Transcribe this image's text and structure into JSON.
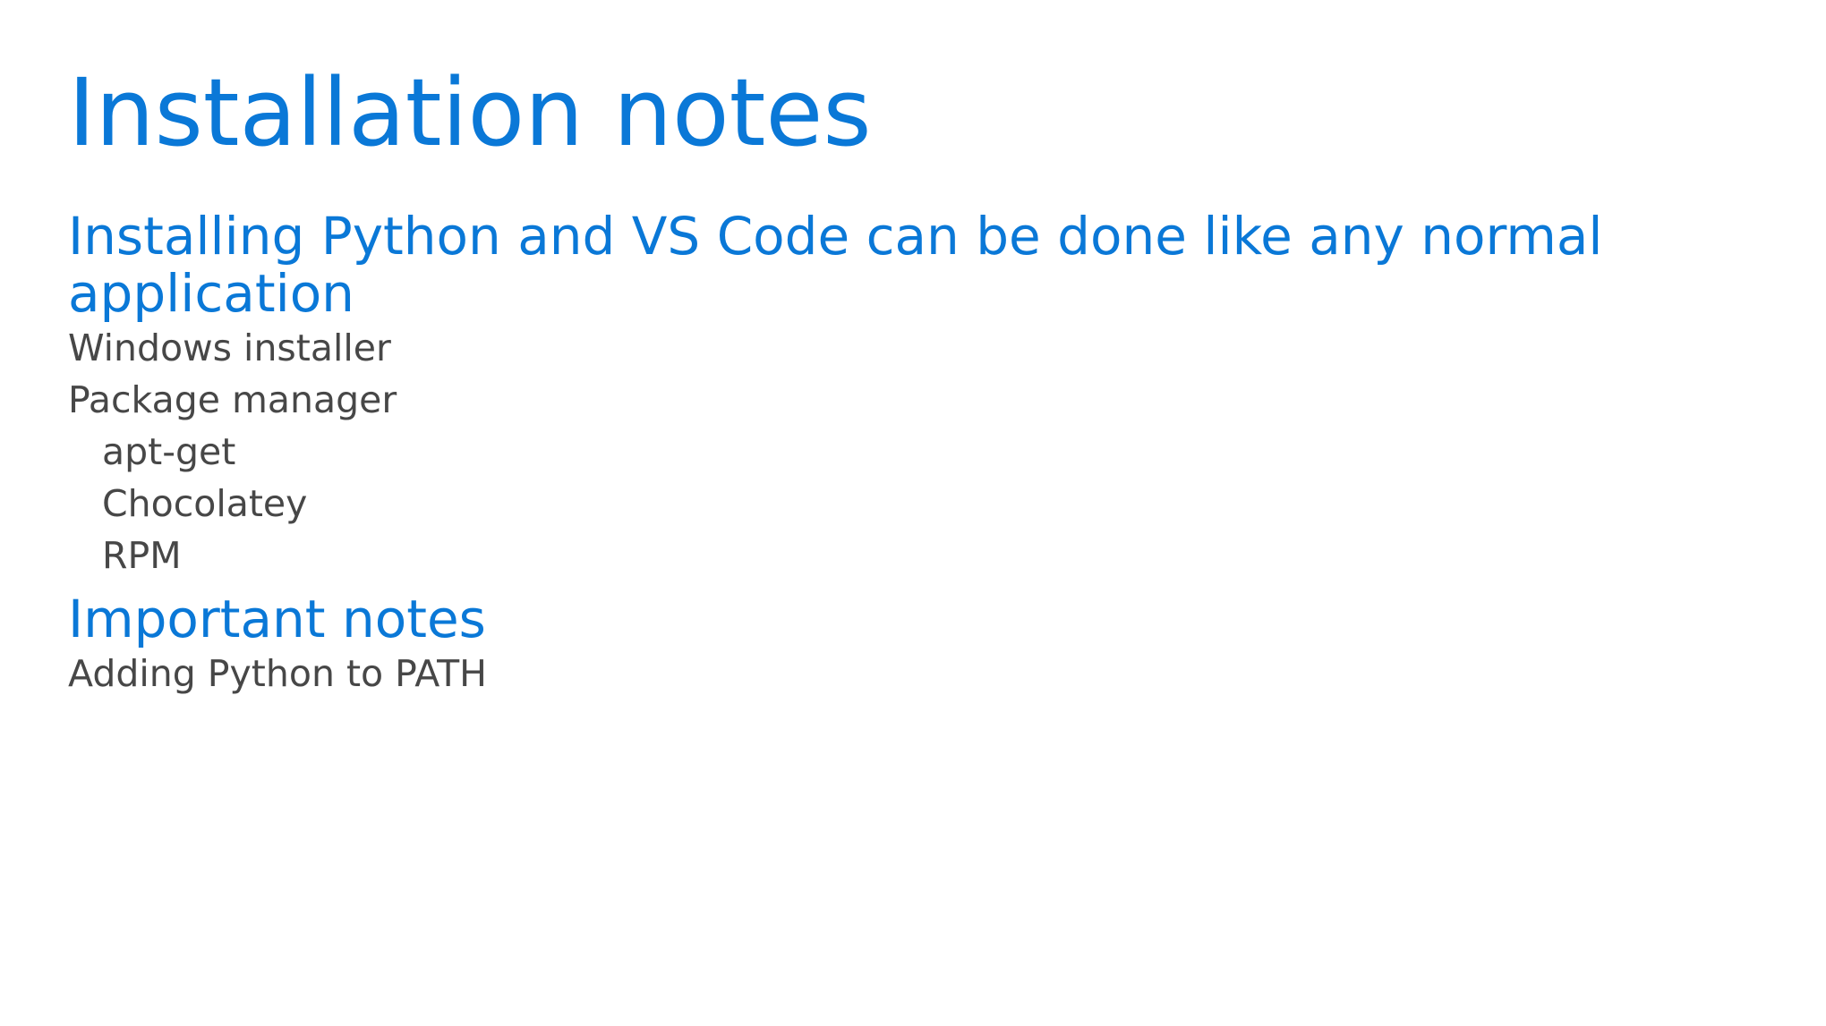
{
  "slide": {
    "title": "Installation notes",
    "sections": [
      {
        "heading": "Installing Python and VS Code can be done like any normal application",
        "items": [
          {
            "text": "Windows installer",
            "level": 1
          },
          {
            "text": "Package manager",
            "level": 1
          },
          {
            "text": "apt-get",
            "level": 2
          },
          {
            "text": "Chocolatey",
            "level": 2
          },
          {
            "text": "RPM",
            "level": 2
          }
        ]
      },
      {
        "heading": "Important notes",
        "items": [
          {
            "text": "Adding Python to PATH",
            "level": 1
          }
        ]
      }
    ]
  },
  "colors": {
    "accent": "#0a78d7",
    "body_text": "#474747",
    "background": "#ffffff"
  }
}
